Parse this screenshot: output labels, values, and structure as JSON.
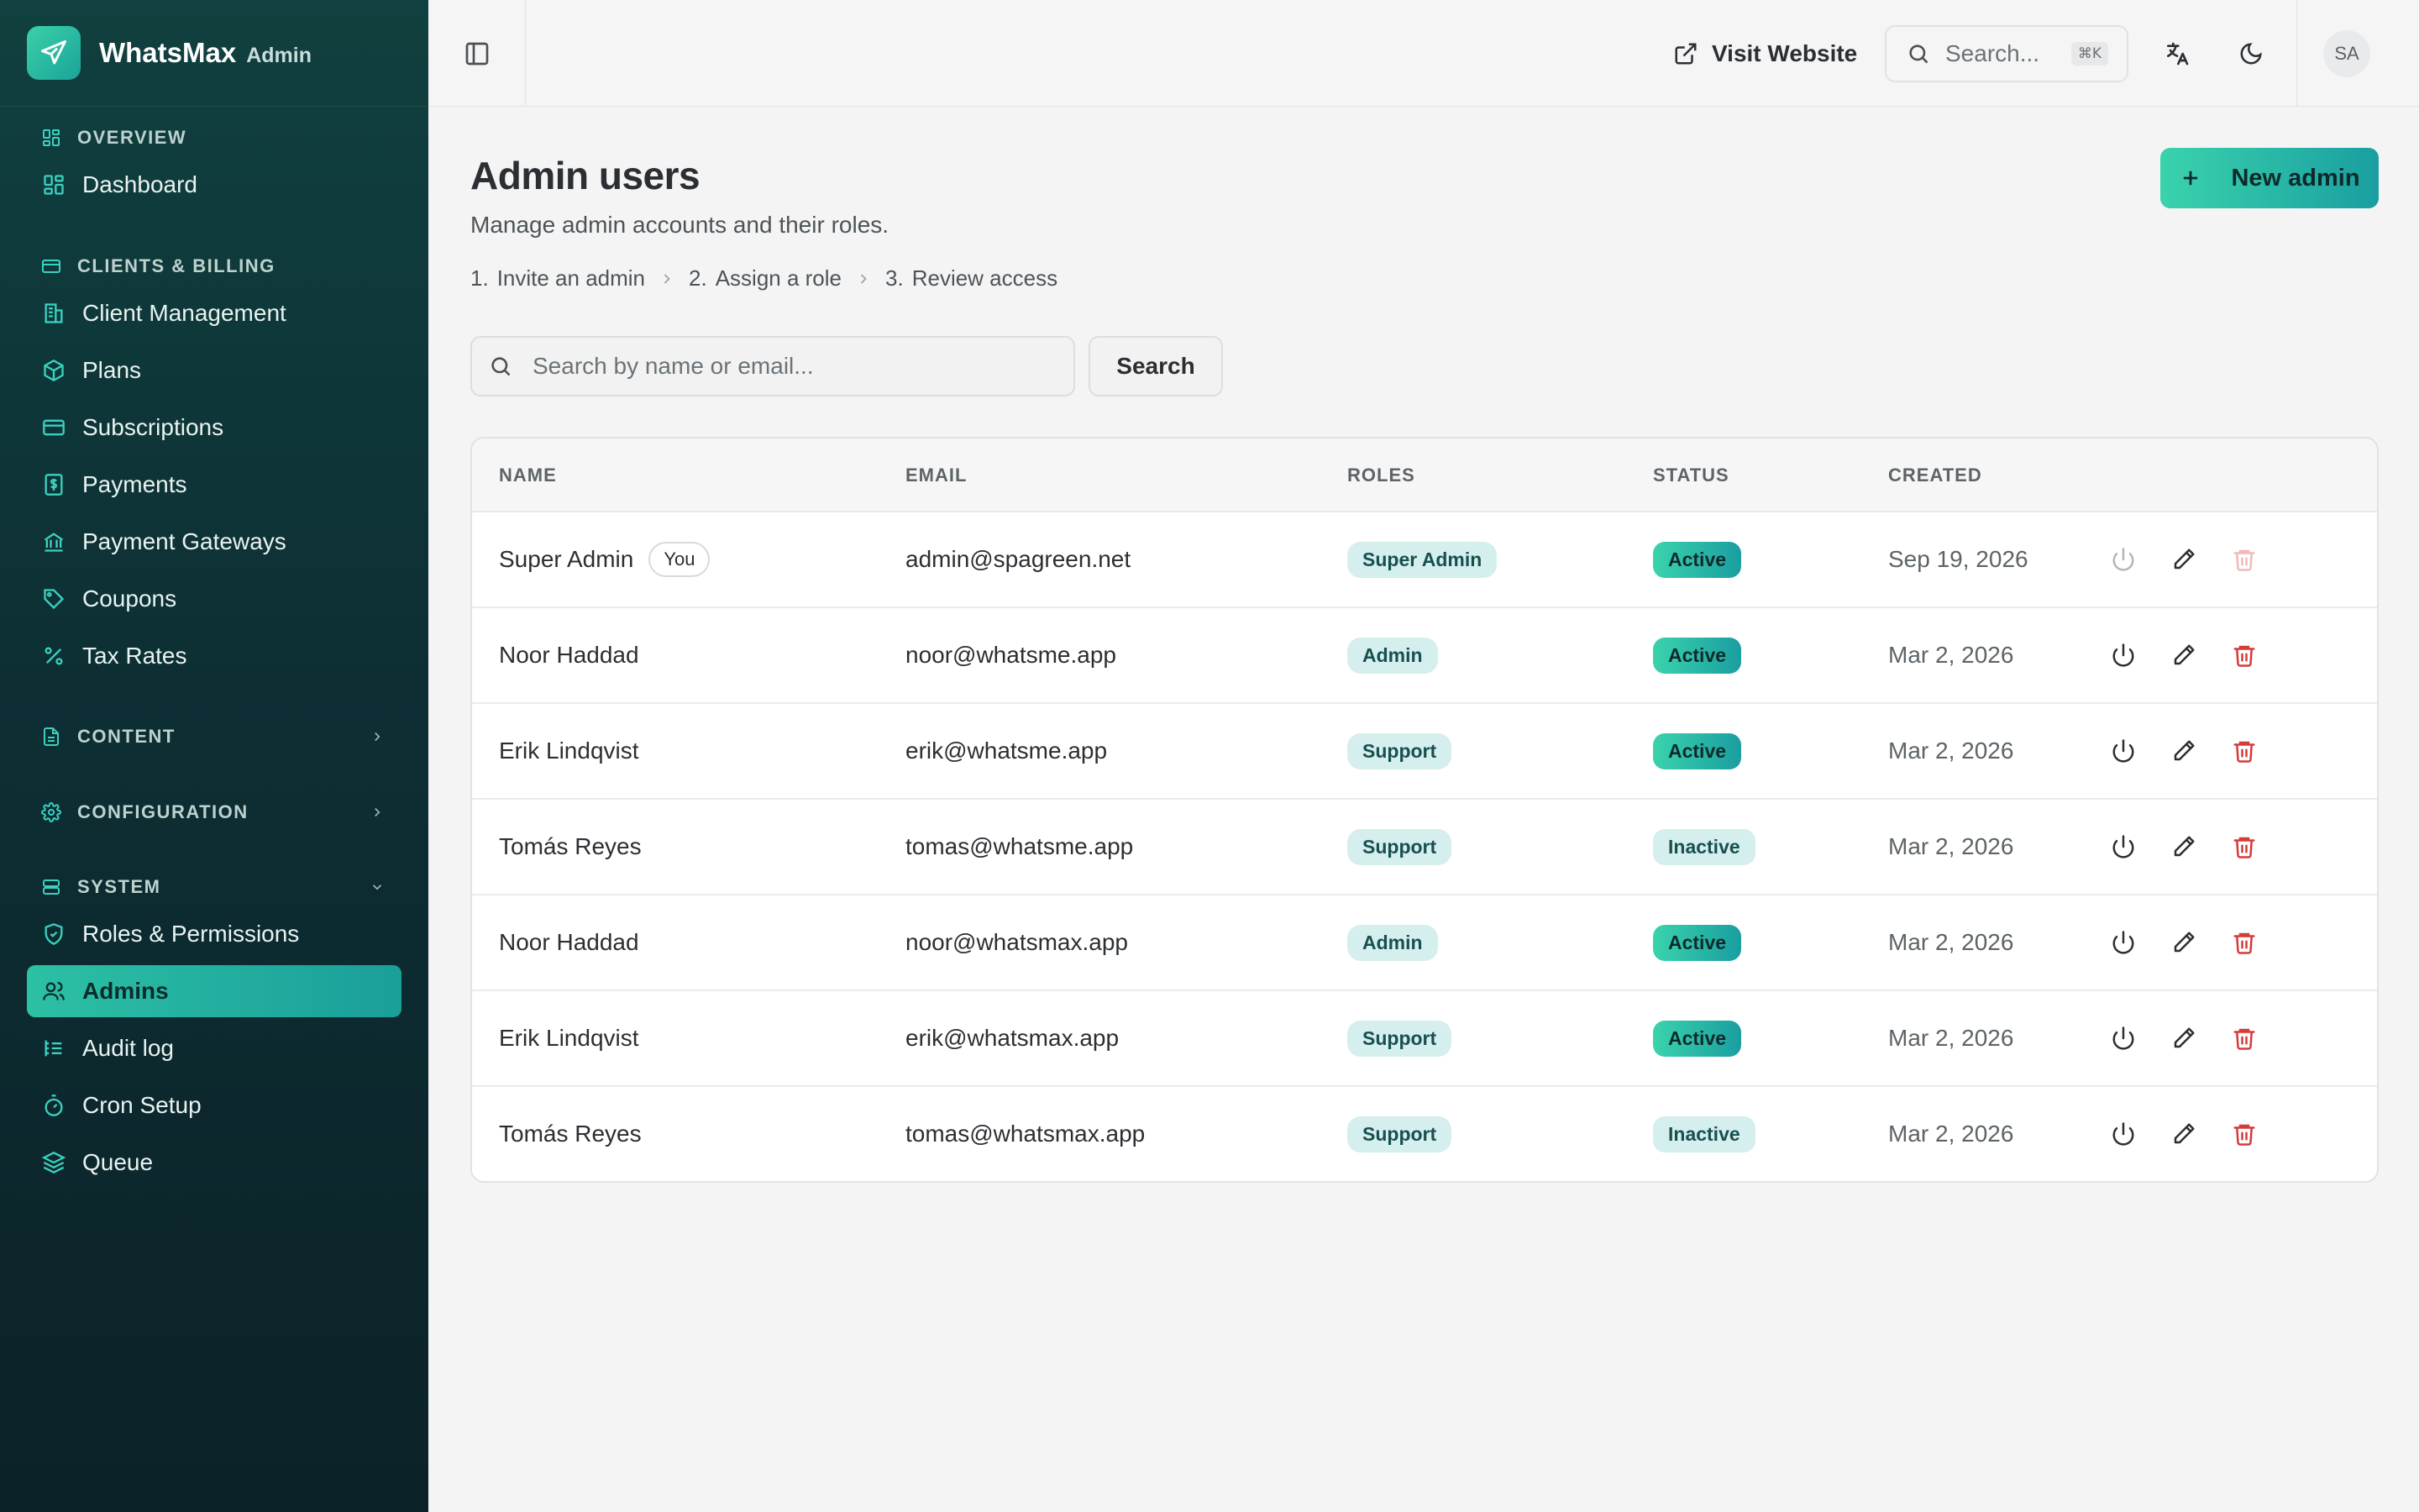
{
  "brand": {
    "name": "WhatsMax",
    "suffix": "Admin"
  },
  "sidebar": {
    "sections": [
      {
        "label": "OVERVIEW",
        "icon": "grid-icon"
      },
      {
        "label": "CLIENTS & BILLING",
        "icon": "card-icon"
      },
      {
        "label": "CONTENT",
        "icon": "document-icon"
      },
      {
        "label": "CONFIGURATION",
        "icon": "gear-icon"
      },
      {
        "label": "SYSTEM",
        "icon": "server-icon"
      }
    ],
    "items": [
      {
        "label": "Dashboard",
        "icon": "dashboard-icon"
      },
      {
        "label": "Client Management",
        "icon": "building-icon"
      },
      {
        "label": "Plans",
        "icon": "box-icon"
      },
      {
        "label": "Subscriptions",
        "icon": "credit-card-icon"
      },
      {
        "label": "Payments",
        "icon": "dollar-receipt-icon"
      },
      {
        "label": "Payment Gateways",
        "icon": "bank-icon"
      },
      {
        "label": "Coupons",
        "icon": "tag-icon"
      },
      {
        "label": "Tax Rates",
        "icon": "percent-icon"
      },
      {
        "label": "Roles & Permissions",
        "icon": "shield-check-icon"
      },
      {
        "label": "Admins",
        "icon": "users-icon",
        "active": true
      },
      {
        "label": "Audit log",
        "icon": "list-tree-icon"
      },
      {
        "label": "Cron Setup",
        "icon": "timer-icon"
      },
      {
        "label": "Queue",
        "icon": "layers-icon"
      }
    ]
  },
  "topbar": {
    "visit_label": "Visit Website",
    "search_placeholder": "Search...",
    "search_shortcut": "⌘K",
    "avatar_initials": "SA"
  },
  "page": {
    "title": "Admin users",
    "subtitle": "Manage admin accounts and their roles.",
    "steps": [
      {
        "num": "1.",
        "label": "Invite an admin"
      },
      {
        "num": "2.",
        "label": "Assign a role"
      },
      {
        "num": "3.",
        "label": "Review access"
      }
    ],
    "new_button": "New admin",
    "search_placeholder": "Search by name or email...",
    "search_button": "Search"
  },
  "table": {
    "headers": {
      "name": "NAME",
      "email": "EMAIL",
      "roles": "ROLES",
      "status": "STATUS",
      "created": "CREATED"
    },
    "you_label": "You",
    "rows": [
      {
        "name": "Super Admin",
        "email": "admin@spagreen.net",
        "role": "Super Admin",
        "status": "Active",
        "created": "Sep 19, 2026"
      },
      {
        "name": "Noor Haddad",
        "email": "noor@whatsme.app",
        "role": "Admin",
        "status": "Active",
        "created": "Mar 2, 2026"
      },
      {
        "name": "Erik Lindqvist",
        "email": "erik@whatsme.app",
        "role": "Support",
        "status": "Active",
        "created": "Mar 2, 2026"
      },
      {
        "name": "Tomás Reyes",
        "email": "tomas@whatsme.app",
        "role": "Support",
        "status": "Inactive",
        "created": "Mar 2, 2026"
      },
      {
        "name": "Noor Haddad",
        "email": "noor@whatsmax.app",
        "role": "Admin",
        "status": "Active",
        "created": "Mar 2, 2026"
      },
      {
        "name": "Erik Lindqvist",
        "email": "erik@whatsmax.app",
        "role": "Support",
        "status": "Active",
        "created": "Mar 2, 2026"
      },
      {
        "name": "Tomás Reyes",
        "email": "tomas@whatsmax.app",
        "role": "Support",
        "status": "Inactive",
        "created": "Mar 2, 2026"
      }
    ]
  },
  "colors": {
    "accent": "#2cc0a5",
    "danger": "#d63a3a",
    "sidebar_bg": "#0d2f34"
  }
}
